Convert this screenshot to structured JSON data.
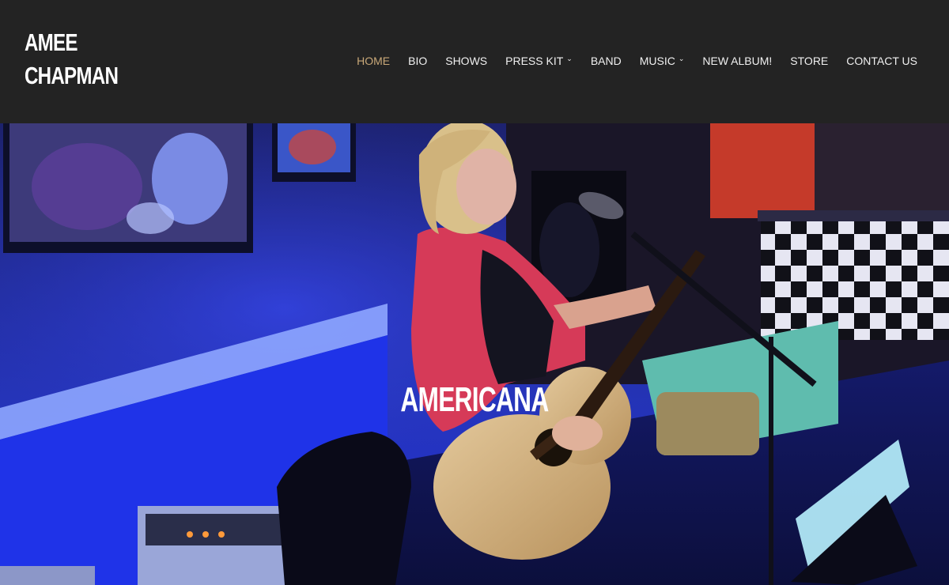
{
  "brand": {
    "line1": "AMEE",
    "line2": "CHAPMAN"
  },
  "nav": {
    "items": [
      {
        "label": "HOME",
        "active": true,
        "dropdown": false
      },
      {
        "label": "BIO",
        "active": false,
        "dropdown": false
      },
      {
        "label": "SHOWS",
        "active": false,
        "dropdown": false
      },
      {
        "label": "PRESS KIT",
        "active": false,
        "dropdown": true
      },
      {
        "label": "BAND",
        "active": false,
        "dropdown": false
      },
      {
        "label": "MUSIC",
        "active": false,
        "dropdown": true
      },
      {
        "label": "NEW ALBUM!",
        "active": false,
        "dropdown": false
      },
      {
        "label": "STORE",
        "active": false,
        "dropdown": false
      },
      {
        "label": "CONTACT US",
        "active": false,
        "dropdown": false
      }
    ],
    "dropdown_icon": "chevron-down-icon"
  },
  "hero": {
    "title": "AMERICANA",
    "image": "singer-performing-with-acoustic-guitar"
  },
  "colors": {
    "header_bg": "#232323",
    "nav_text": "#f0f0f0",
    "nav_active": "#c9a878",
    "hero_tint": "#2330c4"
  }
}
